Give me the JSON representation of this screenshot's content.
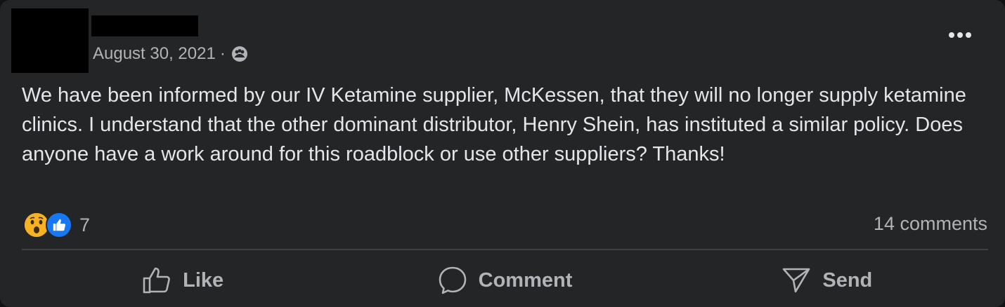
{
  "post": {
    "date": "August 30, 2021",
    "separator": "·",
    "audience_icon": "group-audience-icon",
    "more_icon": "more-options-icon",
    "body": "We have been informed by our IV Ketamine supplier, McKessen, that they will no longer supply ketamine clinics. I understand that the other dominant distributor, Henry Shein, has instituted a similar policy. Does anyone have a work around for this roadblock or use other suppliers? Thanks!"
  },
  "reactions": {
    "icons": [
      "wow-reaction-icon",
      "like-reaction-icon"
    ],
    "count": "7"
  },
  "comments": {
    "label": "14 comments"
  },
  "actions": {
    "like": "Like",
    "comment": "Comment",
    "send": "Send"
  },
  "colors": {
    "background": "#242526",
    "text_primary": "#e4e6eb",
    "text_secondary": "#b0b3b8",
    "like_blue": "#1877f2",
    "wow_yellow": "#f7b125"
  }
}
